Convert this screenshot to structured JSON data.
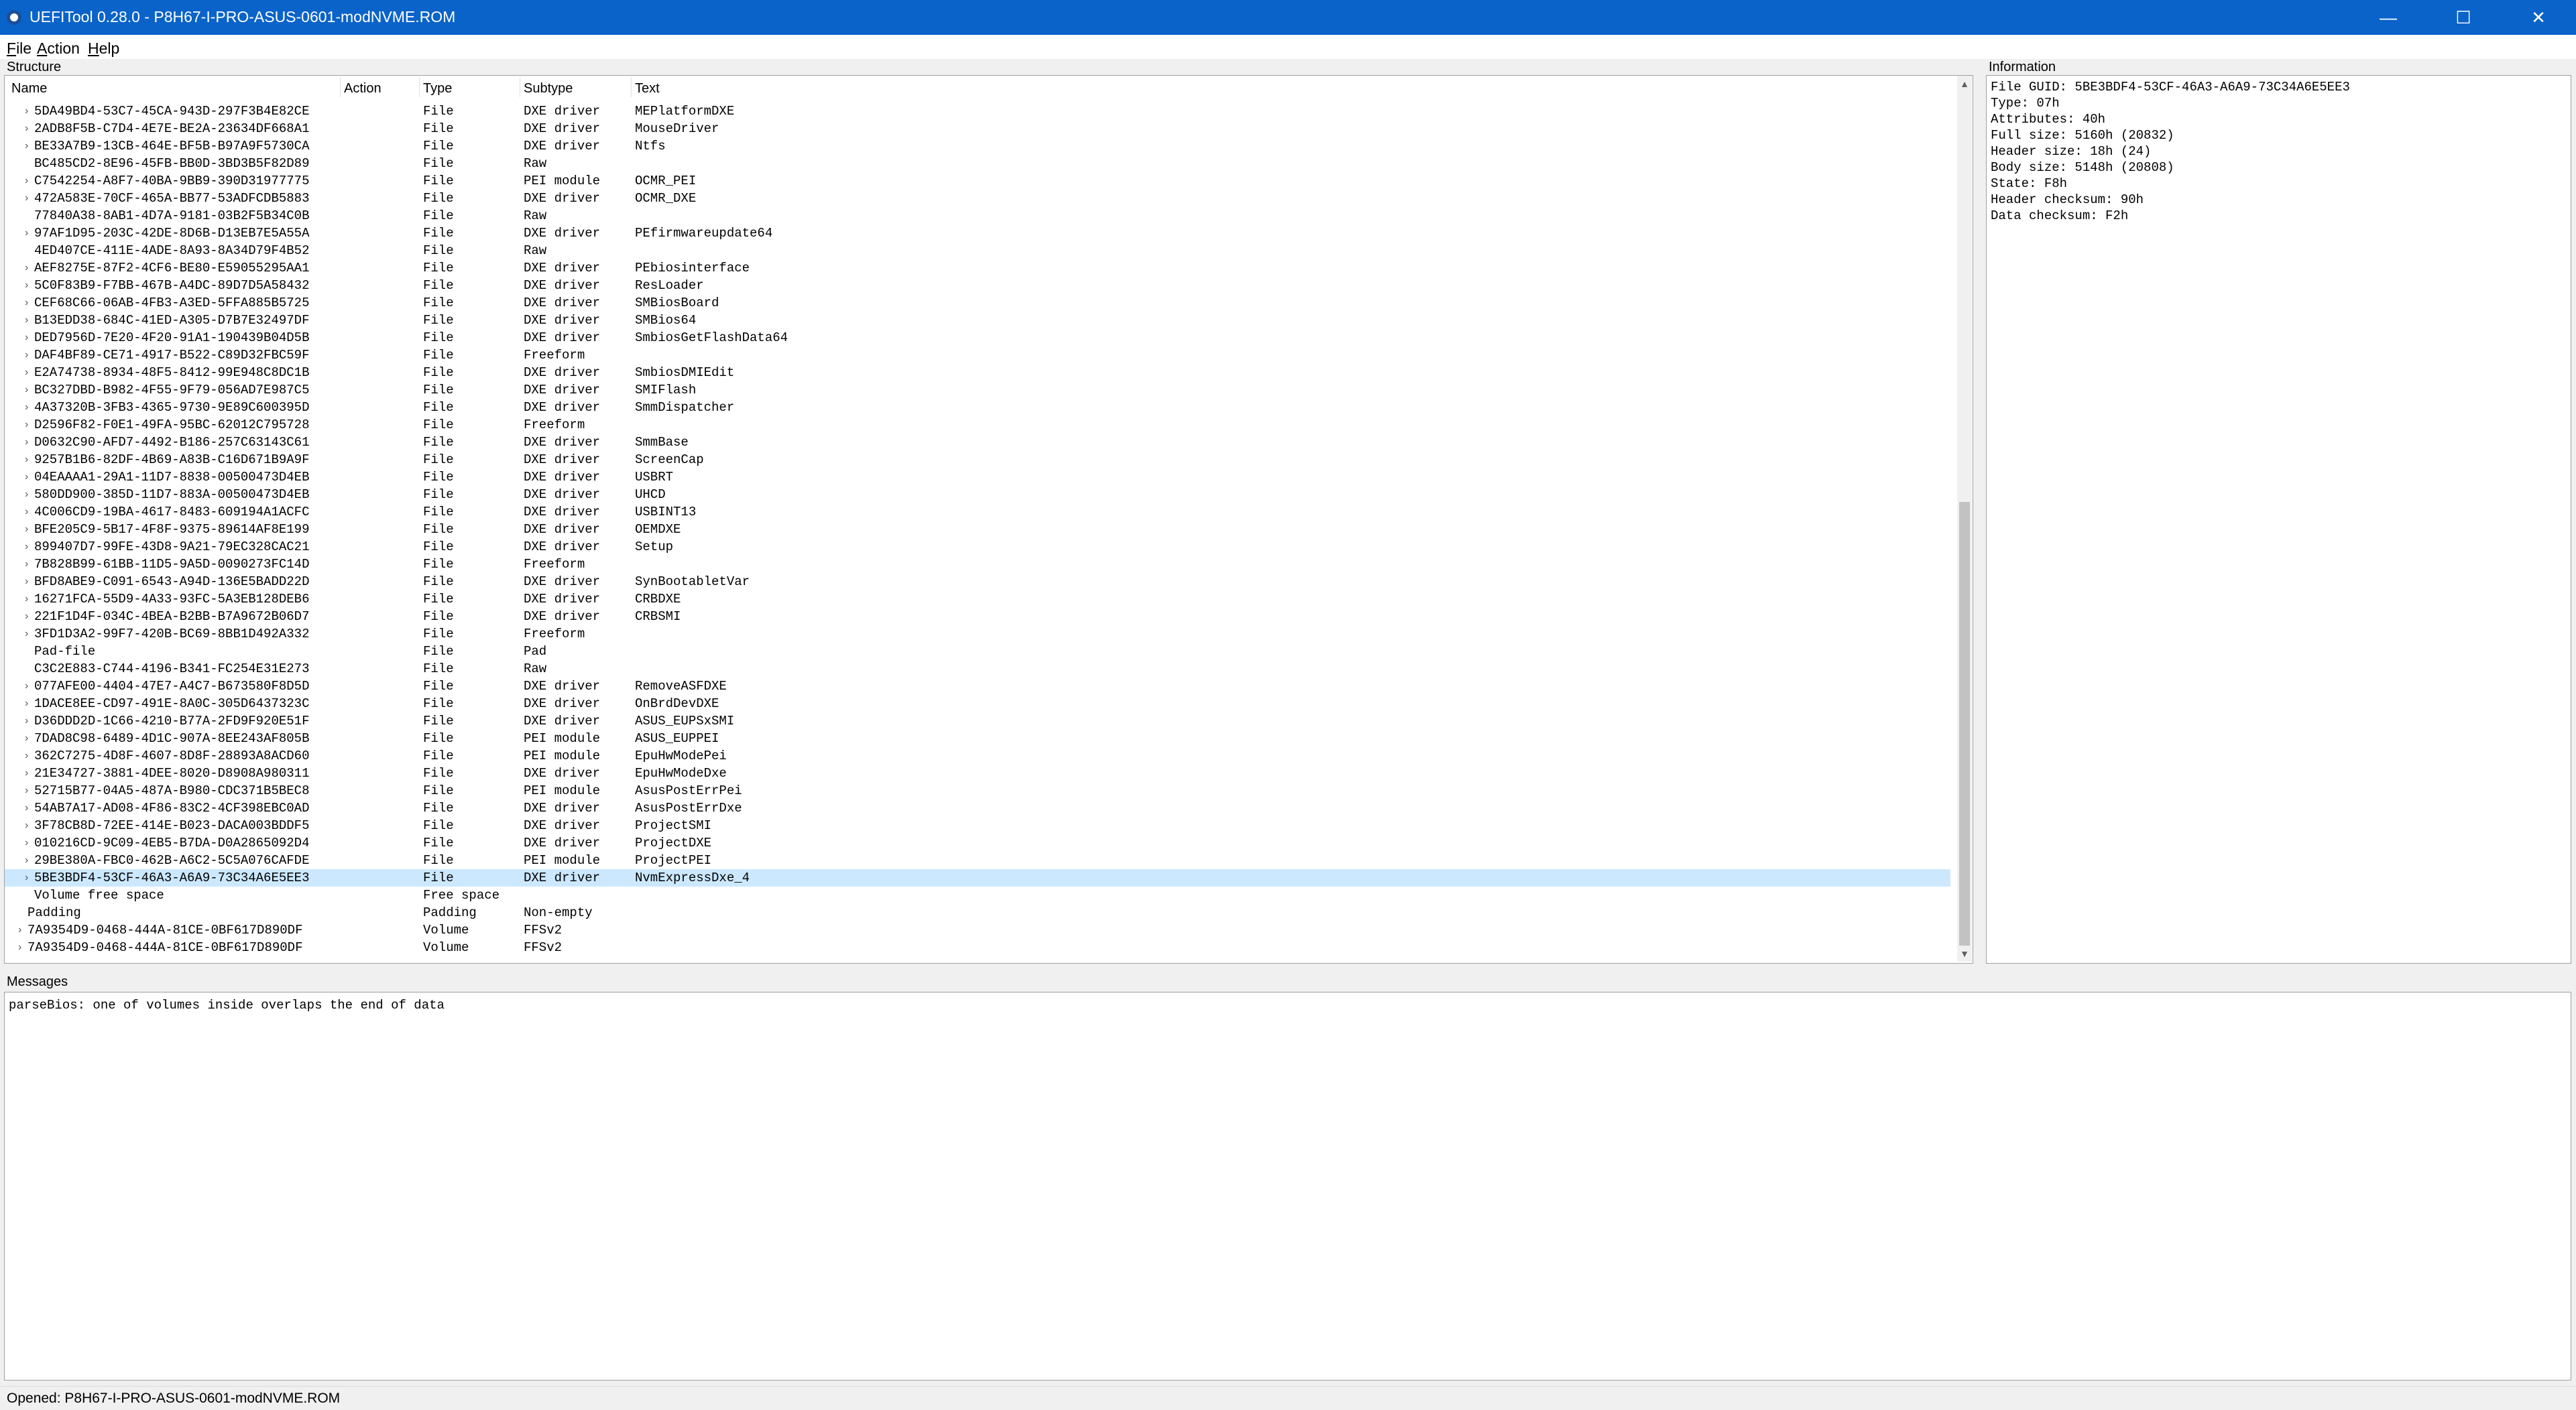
{
  "window": {
    "title": "UEFITool 0.28.0 - P8H67-I-PRO-ASUS-0601-modNVME.ROM"
  },
  "window_controls": {
    "minimize": "—",
    "maximize": "☐",
    "close": "✕"
  },
  "menu": [
    {
      "accel": "F",
      "rest": "ile"
    },
    {
      "accel": "A",
      "rest": "ction"
    },
    {
      "accel": "H",
      "rest": "elp"
    }
  ],
  "structure": {
    "label": "Structure",
    "columns": [
      "Name",
      "Action",
      "Type",
      "Subtype",
      "Text"
    ],
    "rows": [
      {
        "indent": 1,
        "expand": true,
        "name": "5DA49BD4-53C7-45CA-943D-297F3B4E82CE",
        "action": "",
        "type": "File",
        "subtype": "DXE driver",
        "text": "MEPlatformDXE"
      },
      {
        "indent": 1,
        "expand": true,
        "name": "2ADB8F5B-C7D4-4E7E-BE2A-23634DF668A1",
        "action": "",
        "type": "File",
        "subtype": "DXE driver",
        "text": "MouseDriver"
      },
      {
        "indent": 1,
        "expand": true,
        "name": "BE33A7B9-13CB-464E-BF5B-B97A9F5730CA",
        "action": "",
        "type": "File",
        "subtype": "DXE driver",
        "text": "Ntfs"
      },
      {
        "indent": 1,
        "expand": false,
        "name": "BC485CD2-8E96-45FB-BB0D-3BD3B5F82D89",
        "action": "",
        "type": "File",
        "subtype": "Raw",
        "text": ""
      },
      {
        "indent": 1,
        "expand": true,
        "name": "C7542254-A8F7-40BA-9BB9-390D31977775",
        "action": "",
        "type": "File",
        "subtype": "PEI module",
        "text": "OCMR_PEI"
      },
      {
        "indent": 1,
        "expand": true,
        "name": "472A583E-70CF-465A-BB77-53ADFCDB5883",
        "action": "",
        "type": "File",
        "subtype": "DXE driver",
        "text": "OCMR_DXE"
      },
      {
        "indent": 1,
        "expand": false,
        "name": "77840A38-8AB1-4D7A-9181-03B2F5B34C0B",
        "action": "",
        "type": "File",
        "subtype": "Raw",
        "text": ""
      },
      {
        "indent": 1,
        "expand": true,
        "name": "97AF1D95-203C-42DE-8D6B-D13EB7E5A55A",
        "action": "",
        "type": "File",
        "subtype": "DXE driver",
        "text": "PEfirmwareupdate64"
      },
      {
        "indent": 1,
        "expand": false,
        "name": "4ED407CE-411E-4ADE-8A93-8A34D79F4B52",
        "action": "",
        "type": "File",
        "subtype": "Raw",
        "text": ""
      },
      {
        "indent": 1,
        "expand": true,
        "name": "AEF8275E-87F2-4CF6-BE80-E59055295AA1",
        "action": "",
        "type": "File",
        "subtype": "DXE driver",
        "text": "PEbiosinterface"
      },
      {
        "indent": 1,
        "expand": true,
        "name": "5C0F83B9-F7BB-467B-A4DC-89D7D5A58432",
        "action": "",
        "type": "File",
        "subtype": "DXE driver",
        "text": "ResLoader"
      },
      {
        "indent": 1,
        "expand": true,
        "name": "CEF68C66-06AB-4FB3-A3ED-5FFA885B5725",
        "action": "",
        "type": "File",
        "subtype": "DXE driver",
        "text": "SMBiosBoard"
      },
      {
        "indent": 1,
        "expand": true,
        "name": "B13EDD38-684C-41ED-A305-D7B7E32497DF",
        "action": "",
        "type": "File",
        "subtype": "DXE driver",
        "text": "SMBios64"
      },
      {
        "indent": 1,
        "expand": true,
        "name": "DED7956D-7E20-4F20-91A1-190439B04D5B",
        "action": "",
        "type": "File",
        "subtype": "DXE driver",
        "text": "SmbiosGetFlashData64"
      },
      {
        "indent": 1,
        "expand": true,
        "name": "DAF4BF89-CE71-4917-B522-C89D32FBC59F",
        "action": "",
        "type": "File",
        "subtype": "Freeform",
        "text": ""
      },
      {
        "indent": 1,
        "expand": true,
        "name": "E2A74738-8934-48F5-8412-99E948C8DC1B",
        "action": "",
        "type": "File",
        "subtype": "DXE driver",
        "text": "SmbiosDMIEdit"
      },
      {
        "indent": 1,
        "expand": true,
        "name": "BC327DBD-B982-4F55-9F79-056AD7E987C5",
        "action": "",
        "type": "File",
        "subtype": "DXE driver",
        "text": "SMIFlash"
      },
      {
        "indent": 1,
        "expand": true,
        "name": "4A37320B-3FB3-4365-9730-9E89C600395D",
        "action": "",
        "type": "File",
        "subtype": "DXE driver",
        "text": "SmmDispatcher"
      },
      {
        "indent": 1,
        "expand": true,
        "name": "D2596F82-F0E1-49FA-95BC-62012C795728",
        "action": "",
        "type": "File",
        "subtype": "Freeform",
        "text": ""
      },
      {
        "indent": 1,
        "expand": true,
        "name": "D0632C90-AFD7-4492-B186-257C63143C61",
        "action": "",
        "type": "File",
        "subtype": "DXE driver",
        "text": "SmmBase"
      },
      {
        "indent": 1,
        "expand": true,
        "name": "9257B1B6-82DF-4B69-A83B-C16D671B9A9F",
        "action": "",
        "type": "File",
        "subtype": "DXE driver",
        "text": "ScreenCap"
      },
      {
        "indent": 1,
        "expand": true,
        "name": "04EAAAA1-29A1-11D7-8838-00500473D4EB",
        "action": "",
        "type": "File",
        "subtype": "DXE driver",
        "text": "USBRT"
      },
      {
        "indent": 1,
        "expand": true,
        "name": "580DD900-385D-11D7-883A-00500473D4EB",
        "action": "",
        "type": "File",
        "subtype": "DXE driver",
        "text": "UHCD"
      },
      {
        "indent": 1,
        "expand": true,
        "name": "4C006CD9-19BA-4617-8483-609194A1ACFC",
        "action": "",
        "type": "File",
        "subtype": "DXE driver",
        "text": "USBINT13"
      },
      {
        "indent": 1,
        "expand": true,
        "name": "BFE205C9-5B17-4F8F-9375-89614AF8E199",
        "action": "",
        "type": "File",
        "subtype": "DXE driver",
        "text": "OEMDXE"
      },
      {
        "indent": 1,
        "expand": true,
        "name": "899407D7-99FE-43D8-9A21-79EC328CAC21",
        "action": "",
        "type": "File",
        "subtype": "DXE driver",
        "text": "Setup"
      },
      {
        "indent": 1,
        "expand": true,
        "name": "7B828B99-61BB-11D5-9A5D-0090273FC14D",
        "action": "",
        "type": "File",
        "subtype": "Freeform",
        "text": ""
      },
      {
        "indent": 1,
        "expand": true,
        "name": "BFD8ABE9-C091-6543-A94D-136E5BADD22D",
        "action": "",
        "type": "File",
        "subtype": "DXE driver",
        "text": "SynBootabletVar"
      },
      {
        "indent": 1,
        "expand": true,
        "name": "16271FCA-55D9-4A33-93FC-5A3EB128DEB6",
        "action": "",
        "type": "File",
        "subtype": "DXE driver",
        "text": "CRBDXE"
      },
      {
        "indent": 1,
        "expand": true,
        "name": "221F1D4F-034C-4BEA-B2BB-B7A9672B06D7",
        "action": "",
        "type": "File",
        "subtype": "DXE driver",
        "text": "CRBSMI"
      },
      {
        "indent": 1,
        "expand": true,
        "name": "3FD1D3A2-99F7-420B-BC69-8BB1D492A332",
        "action": "",
        "type": "File",
        "subtype": "Freeform",
        "text": ""
      },
      {
        "indent": 1,
        "expand": false,
        "name": "Pad-file",
        "action": "",
        "type": "File",
        "subtype": "Pad",
        "text": ""
      },
      {
        "indent": 1,
        "expand": false,
        "name": "C3C2E883-C744-4196-B341-FC254E31E273",
        "action": "",
        "type": "File",
        "subtype": "Raw",
        "text": ""
      },
      {
        "indent": 1,
        "expand": true,
        "name": "077AFE00-4404-47E7-A4C7-B673580F8D5D",
        "action": "",
        "type": "File",
        "subtype": "DXE driver",
        "text": "RemoveASFDXE"
      },
      {
        "indent": 1,
        "expand": true,
        "name": "1DACE8EE-CD97-491E-8A0C-305D6437323C",
        "action": "",
        "type": "File",
        "subtype": "DXE driver",
        "text": "OnBrdDevDXE"
      },
      {
        "indent": 1,
        "expand": true,
        "name": "D36DDD2D-1C66-4210-B77A-2FD9F920E51F",
        "action": "",
        "type": "File",
        "subtype": "DXE driver",
        "text": "ASUS_EUPSxSMI"
      },
      {
        "indent": 1,
        "expand": true,
        "name": "7DAD8C98-6489-4D1C-907A-8EE243AF805B",
        "action": "",
        "type": "File",
        "subtype": "PEI module",
        "text": "ASUS_EUPPEI"
      },
      {
        "indent": 1,
        "expand": true,
        "name": "362C7275-4D8F-4607-8D8F-28893A8ACD60",
        "action": "",
        "type": "File",
        "subtype": "PEI module",
        "text": "EpuHwModePei"
      },
      {
        "indent": 1,
        "expand": true,
        "name": "21E34727-3881-4DEE-8020-D8908A980311",
        "action": "",
        "type": "File",
        "subtype": "DXE driver",
        "text": "EpuHwModeDxe"
      },
      {
        "indent": 1,
        "expand": true,
        "name": "52715B77-04A5-487A-B980-CDC371B5BEC8",
        "action": "",
        "type": "File",
        "subtype": "PEI module",
        "text": "AsusPostErrPei"
      },
      {
        "indent": 1,
        "expand": true,
        "name": "54AB7A17-AD08-4F86-83C2-4CF398EBC0AD",
        "action": "",
        "type": "File",
        "subtype": "DXE driver",
        "text": "AsusPostErrDxe"
      },
      {
        "indent": 1,
        "expand": true,
        "name": "3F78CB8D-72EE-414E-B023-DACA003BDDF5",
        "action": "",
        "type": "File",
        "subtype": "DXE driver",
        "text": "ProjectSMI"
      },
      {
        "indent": 1,
        "expand": true,
        "name": "010216CD-9C09-4EB5-B7DA-D0A2865092D4",
        "action": "",
        "type": "File",
        "subtype": "DXE driver",
        "text": "ProjectDXE"
      },
      {
        "indent": 1,
        "expand": true,
        "name": "29BE380A-FBC0-462B-A6C2-5C5A076CAFDE",
        "action": "",
        "type": "File",
        "subtype": "PEI module",
        "text": "ProjectPEI"
      },
      {
        "indent": 1,
        "expand": true,
        "name": "5BE3BDF4-53CF-46A3-A6A9-73C34A6E5EE3",
        "action": "",
        "type": "File",
        "subtype": "DXE driver",
        "text": "NvmExpressDxe_4",
        "selected": true
      },
      {
        "indent": 1,
        "expand": false,
        "name": "Volume free space",
        "action": "",
        "type": "Free space",
        "subtype": "",
        "text": ""
      },
      {
        "indent": 0,
        "expand": false,
        "name": "Padding",
        "action": "",
        "type": "Padding",
        "subtype": "Non-empty",
        "text": ""
      },
      {
        "indent": 0,
        "expand": true,
        "name": "7A9354D9-0468-444A-81CE-0BF617D890DF",
        "action": "",
        "type": "Volume",
        "subtype": "FFSv2",
        "text": ""
      },
      {
        "indent": 0,
        "expand": true,
        "name": "7A9354D9-0468-444A-81CE-0BF617D890DF",
        "action": "",
        "type": "Volume",
        "subtype": "FFSv2",
        "text": ""
      }
    ],
    "scrollbar": {
      "up": "▲",
      "down": "▼",
      "thumb_start": 0.48,
      "thumb_end": 1.0
    }
  },
  "information": {
    "label": "Information",
    "lines": [
      "File GUID: 5BE3BDF4-53CF-46A3-A6A9-73C34A6E5EE3",
      "Type: 07h",
      "Attributes: 40h",
      "Full size: 5160h (20832)",
      "Header size: 18h (24)",
      "Body size: 5148h (20808)",
      "State: F8h",
      "Header checksum: 90h",
      "Data checksum: F2h"
    ]
  },
  "messages": {
    "label": "Messages",
    "lines": [
      "parseBios: one of volumes inside overlaps the end of data"
    ]
  },
  "status": {
    "text": "Opened: P8H67-I-PRO-ASUS-0601-modNVME.ROM"
  },
  "tree_glyph": "›"
}
